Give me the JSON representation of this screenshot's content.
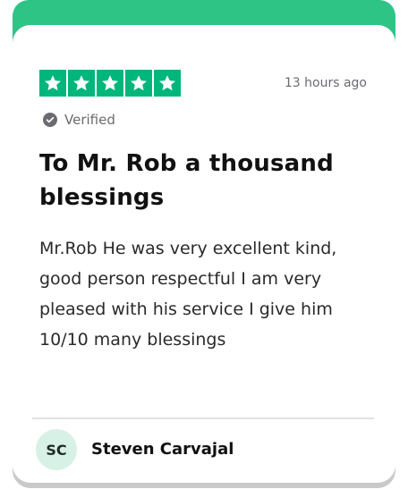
{
  "review": {
    "rating": 5,
    "rating_max": 5,
    "time_ago": "13 hours ago",
    "verified_label": "Verified",
    "title": "To Mr. Rob a thousand blessings",
    "body": "Mr.Rob He was very excellent kind, good person respectful I am very pleased with his service I give him 10/10 many blessings",
    "author": {
      "initials": "SC",
      "name": "Steven Carvajal"
    }
  },
  "colors": {
    "accent": "#2ec486",
    "star_bg": "#00b67a",
    "star_fg": "#ffffff",
    "avatar_bg": "#d8f1e6",
    "muted_text": "#6b6b70"
  },
  "icons": {
    "star": "star-icon",
    "verified": "verified-check-icon"
  }
}
